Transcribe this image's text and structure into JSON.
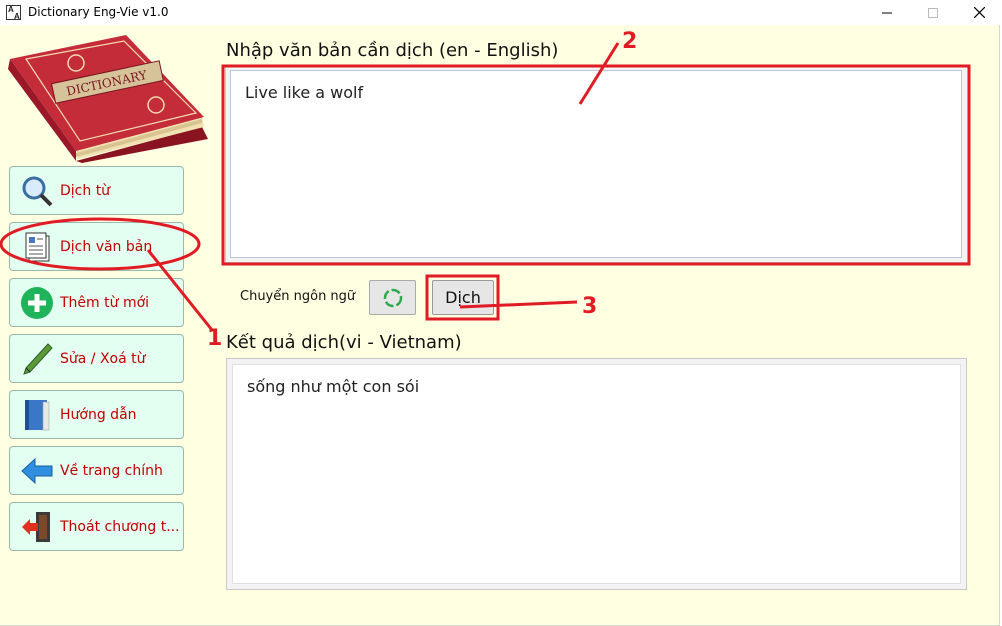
{
  "window": {
    "title": "Dictionary Eng-Vie v1.0",
    "minimize_glyph": "—",
    "maximize_glyph": "☐",
    "close_glyph": "✕"
  },
  "sidebar": {
    "logo_text": "DICTIONARY",
    "items": [
      {
        "label": "Dịch từ",
        "icon": "magnifier-icon"
      },
      {
        "label": "Dịch văn bản",
        "icon": "document-icon"
      },
      {
        "label": "Thêm từ mới",
        "icon": "plus-icon"
      },
      {
        "label": "Sửa / Xoá từ",
        "icon": "pen-icon"
      },
      {
        "label": "Hướng dẫn",
        "icon": "book-icon"
      },
      {
        "label": "Về trang chính",
        "icon": "arrow-left-icon"
      },
      {
        "label": "Thoát chương t...",
        "icon": "exit-door-icon"
      }
    ]
  },
  "main": {
    "input_label": "Nhập văn bản cần dịch (en - English)",
    "input_value": "Live like a wolf",
    "switch_language_label": "Chuyển ngôn ngữ",
    "translate_button": "Dịch",
    "result_label": "Kết quả dịch(vi - Vietnam)",
    "result_value": "sống như một con sói"
  },
  "annotations": {
    "color": "#e01b24",
    "numbers": [
      "1",
      "2",
      "3"
    ]
  }
}
